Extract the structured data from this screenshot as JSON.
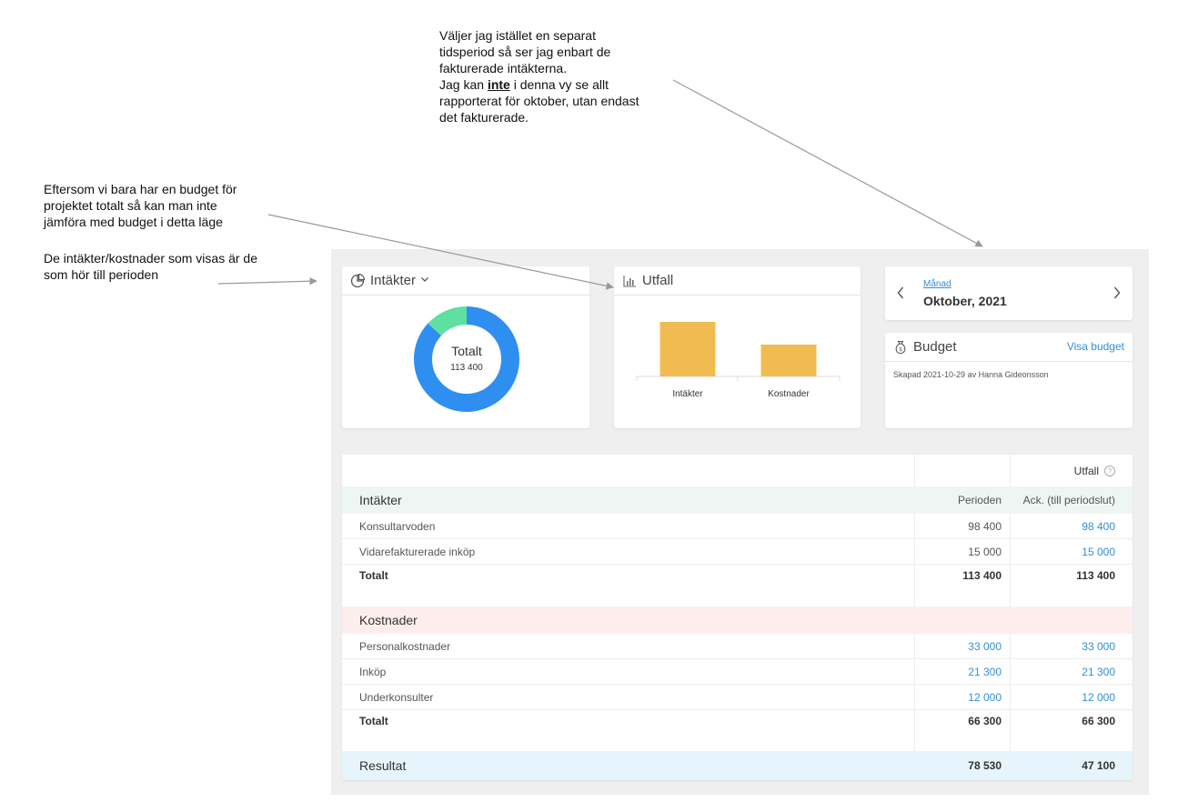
{
  "notes": {
    "top": {
      "line1": "Väljer jag istället en separat",
      "line2": "tidsperiod så ser jag enbart de",
      "line3": "fakturerade intäkterna.",
      "line4_pre": "Jag kan ",
      "line4_emph": "inte",
      "line4_post": " i denna vy se allt",
      "line5": "rapporterat för oktober, utan endast",
      "line6": "det fakturerade."
    },
    "left1": {
      "line1": "Eftersom vi bara har en budget för",
      "line2": "projektet totalt så kan man inte",
      "line3": "jämföra med budget i detta läge"
    },
    "left2": {
      "line1": "De intäkter/kostnader som visas är de",
      "line2": "som hör till perioden"
    }
  },
  "intakter_card": {
    "title": "Intäkter",
    "icon": "pie-chart-icon",
    "center_label": "Totalt",
    "center_value": "113 400",
    "slices": [
      {
        "label": "Konsultarvoden",
        "value": 98400,
        "color": "#2f8ff0"
      },
      {
        "label": "Vidarefakturerade inköp",
        "value": 15000,
        "color": "#5ee0a0"
      }
    ]
  },
  "utfall_card": {
    "title": "Utfall",
    "icon": "bar-chart-icon",
    "bar_color": "#f0bc52"
  },
  "chart_data": {
    "type": "bar",
    "categories": [
      "Intäkter",
      "Kostnader"
    ],
    "values": [
      113400,
      66300
    ],
    "title": "",
    "xlabel": "",
    "ylabel": "",
    "ylim": [
      0,
      113400
    ]
  },
  "period_card": {
    "mode_link": "Månad",
    "value": "Oktober, 2021"
  },
  "budget_card": {
    "title": "Budget",
    "icon": "money-bag-icon",
    "link": "Visa budget",
    "created": "Skapad 2021-10-29 av Hanna Gideonsson"
  },
  "table": {
    "header_utfall": "Utfall",
    "intakter": {
      "title": "Intäkter",
      "col1": "Perioden",
      "col2": "Ack. (till periodslut)",
      "rows": [
        {
          "label": "Konsultarvoden",
          "period": "98 400",
          "ack": "98 400"
        },
        {
          "label": "Vidarefakturerade inköp",
          "period": "15 000",
          "ack": "15 000"
        }
      ],
      "total_label": "Totalt",
      "total_period": "113 400",
      "total_ack": "113 400"
    },
    "kostnader": {
      "title": "Kostnader",
      "rows": [
        {
          "label": "Personalkostnader",
          "period": "33 000",
          "ack": "33 000"
        },
        {
          "label": "Inköp",
          "period": "21 300",
          "ack": "21 300"
        },
        {
          "label": "Underkonsulter",
          "period": "12 000",
          "ack": "12 000"
        }
      ],
      "total_label": "Totalt",
      "total_period": "66 300",
      "total_ack": "66 300"
    },
    "resultat": {
      "label": "Resultat",
      "period": "78 530",
      "ack": "47 100"
    }
  }
}
